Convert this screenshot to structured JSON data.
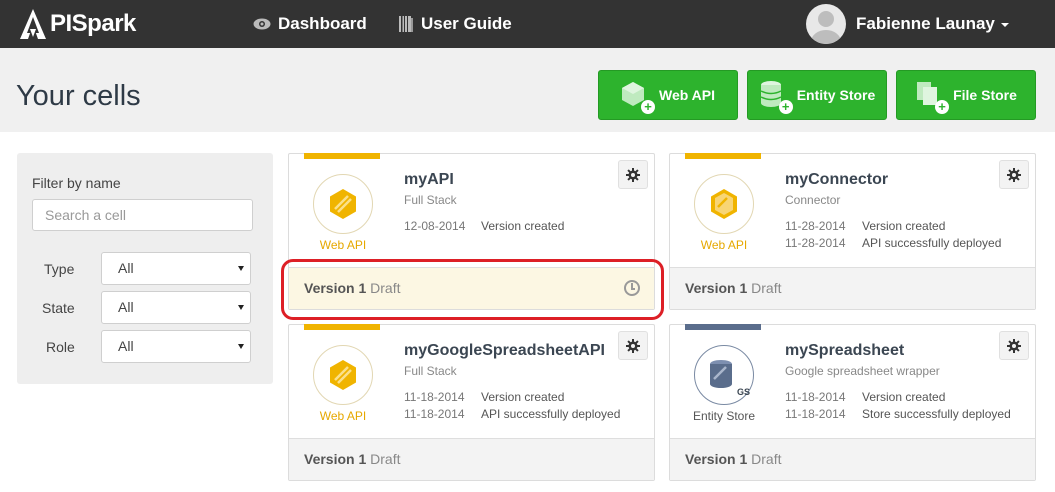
{
  "app": {
    "name": "PISpark"
  },
  "nav": {
    "items": [
      {
        "label": "Dashboard",
        "icon": "eye-icon"
      },
      {
        "label": "User Guide",
        "icon": "book-icon"
      }
    ],
    "user": {
      "name": "Fabienne Launay"
    }
  },
  "header": {
    "title": "Your cells",
    "buttons": [
      {
        "label": "Web API",
        "icon": "web-api-add-icon"
      },
      {
        "label": "Entity Store",
        "icon": "database-add-icon"
      },
      {
        "label": "File Store",
        "icon": "files-add-icon"
      }
    ]
  },
  "filter": {
    "title": "Filter by name",
    "search_placeholder": "Search a cell",
    "rows": [
      {
        "label": "Type",
        "value": "All"
      },
      {
        "label": "State",
        "value": "All"
      },
      {
        "label": "Role",
        "value": "All"
      }
    ]
  },
  "colors": {
    "accent_yellow": "#f0b400",
    "accent_slate": "#5a6d8c",
    "green_button": "#2db32d",
    "highlight_red": "#dd1f26"
  },
  "cards": [
    {
      "name": "myAPI",
      "subtitle": "Full Stack",
      "type_label": "Web API",
      "events": [
        {
          "date": "12-08-2014",
          "text": "Version created"
        }
      ],
      "version_label": "Version 1",
      "state": "Draft"
    },
    {
      "name": "myConnector",
      "subtitle": "Connector",
      "type_label": "Web API",
      "events": [
        {
          "date": "11-28-2014",
          "text": "Version created"
        },
        {
          "date": "11-28-2014",
          "text": "API successfully deployed"
        }
      ],
      "version_label": "Version 1",
      "state": "Draft"
    },
    {
      "name": "myGoogleSpreadsheetAPI",
      "subtitle": "Full Stack",
      "type_label": "Web API",
      "events": [
        {
          "date": "11-18-2014",
          "text": "Version created"
        },
        {
          "date": "11-18-2014",
          "text": "API successfully deployed"
        }
      ],
      "version_label": "Version 1",
      "state": "Draft"
    },
    {
      "name": "mySpreadsheet",
      "subtitle": "Google spreadsheet wrapper",
      "type_label": "Entity Store",
      "badge": "GS",
      "events": [
        {
          "date": "11-18-2014",
          "text": "Version created"
        },
        {
          "date": "11-18-2014",
          "text": "Store successfully deployed"
        }
      ],
      "version_label": "Version 1",
      "state": "Draft"
    }
  ]
}
